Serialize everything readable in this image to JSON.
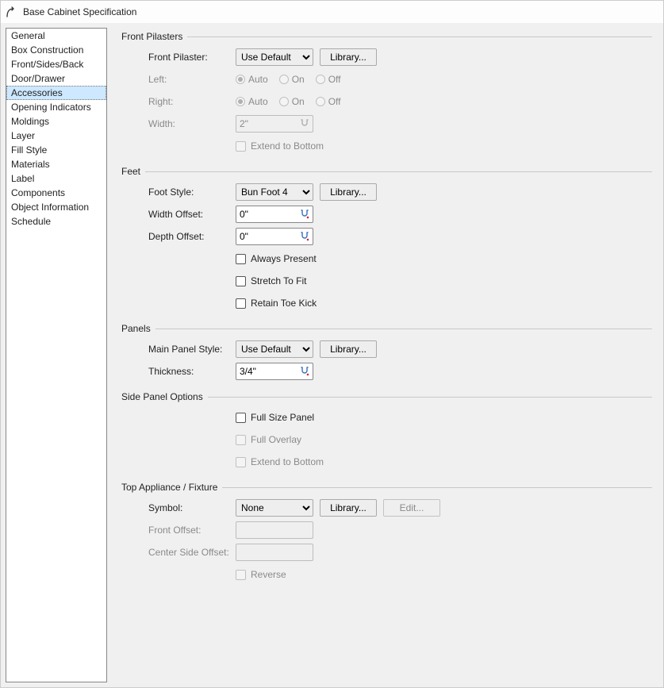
{
  "window": {
    "title": "Base Cabinet Specification"
  },
  "sidebar": {
    "items": [
      "General",
      "Box Construction",
      "Front/Sides/Back",
      "Door/Drawer",
      "Accessories",
      "Opening Indicators",
      "Moldings",
      "Layer",
      "Fill Style",
      "Materials",
      "Label",
      "Components",
      "Object Information",
      "Schedule"
    ],
    "selected_index": 4
  },
  "groups": {
    "front_pilasters": {
      "title": "Front Pilasters",
      "front_pilaster": {
        "label": "Front Pilaster:",
        "value": "Use Default",
        "library": "Library..."
      },
      "left": {
        "label": "Left:",
        "options": [
          "Auto",
          "On",
          "Off"
        ],
        "checked": "Auto"
      },
      "right": {
        "label": "Right:",
        "options": [
          "Auto",
          "On",
          "Off"
        ],
        "checked": "Auto"
      },
      "width": {
        "label": "Width:",
        "value": "2\""
      },
      "extend": {
        "label": "Extend to Bottom"
      }
    },
    "feet": {
      "title": "Feet",
      "foot_style": {
        "label": "Foot Style:",
        "value": "Bun Foot 4",
        "library": "Library..."
      },
      "width_offset": {
        "label": "Width Offset:",
        "value": "0\""
      },
      "depth_offset": {
        "label": "Depth Offset:",
        "value": "0\""
      },
      "always_present": {
        "label": "Always Present"
      },
      "stretch_to_fit": {
        "label": "Stretch To Fit"
      },
      "retain_toe_kick": {
        "label": "Retain Toe Kick"
      }
    },
    "panels": {
      "title": "Panels",
      "main_panel_style": {
        "label": "Main Panel Style:",
        "value": "Use Default",
        "library": "Library..."
      },
      "thickness": {
        "label": "Thickness:",
        "value": "3/4\""
      }
    },
    "side_panel": {
      "title": "Side Panel Options",
      "full_size": {
        "label": "Full Size Panel"
      },
      "full_overlay": {
        "label": "Full Overlay"
      },
      "extend": {
        "label": "Extend to Bottom"
      }
    },
    "top_appliance": {
      "title": "Top Appliance / Fixture",
      "symbol": {
        "label": "Symbol:",
        "value": "None",
        "library": "Library...",
        "edit": "Edit..."
      },
      "front_offset": {
        "label": "Front Offset:"
      },
      "center_side_offset": {
        "label": "Center Side Offset:"
      },
      "reverse": {
        "label": "Reverse"
      }
    }
  }
}
